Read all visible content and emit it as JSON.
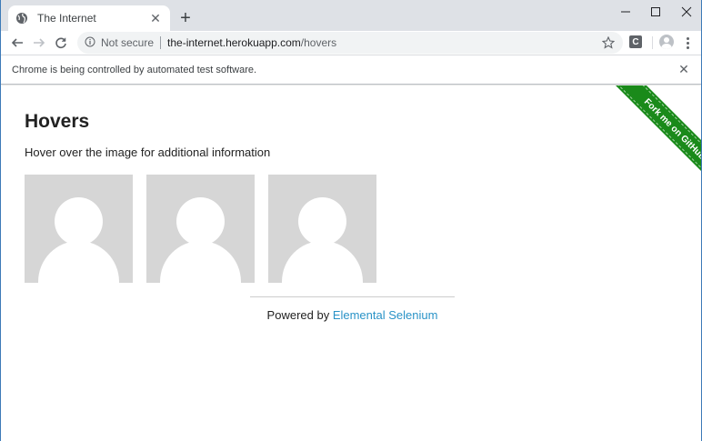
{
  "browser": {
    "tab": {
      "title": "The Internet",
      "favicon": "globe-icon",
      "close_icon": "close-icon"
    },
    "new_tab_icon": "plus-icon",
    "window_controls": [
      "minimize-icon",
      "maximize-icon",
      "close-icon"
    ],
    "address": {
      "security_label": "Not secure",
      "host": "the-internet.herokuapp.com",
      "path": "/hovers"
    },
    "extension_label": "C",
    "infobar": {
      "message": "Chrome is being controlled by automated test software."
    }
  },
  "page": {
    "heading": "Hovers",
    "description": "Hover over the image for additional information",
    "figures": [
      {
        "alt": "User Avatar"
      },
      {
        "alt": "User Avatar"
      },
      {
        "alt": "User Avatar"
      }
    ],
    "footer": {
      "prefix": "Powered by ",
      "link_text": "Elemental Selenium"
    },
    "ribbon": "Fork me on GitHub"
  },
  "colors": {
    "tabstrip": "#dee1e6",
    "link": "#2a93c7",
    "ribbon": "#1a8a1a",
    "avatar_bg": "#d6d6d6"
  }
}
